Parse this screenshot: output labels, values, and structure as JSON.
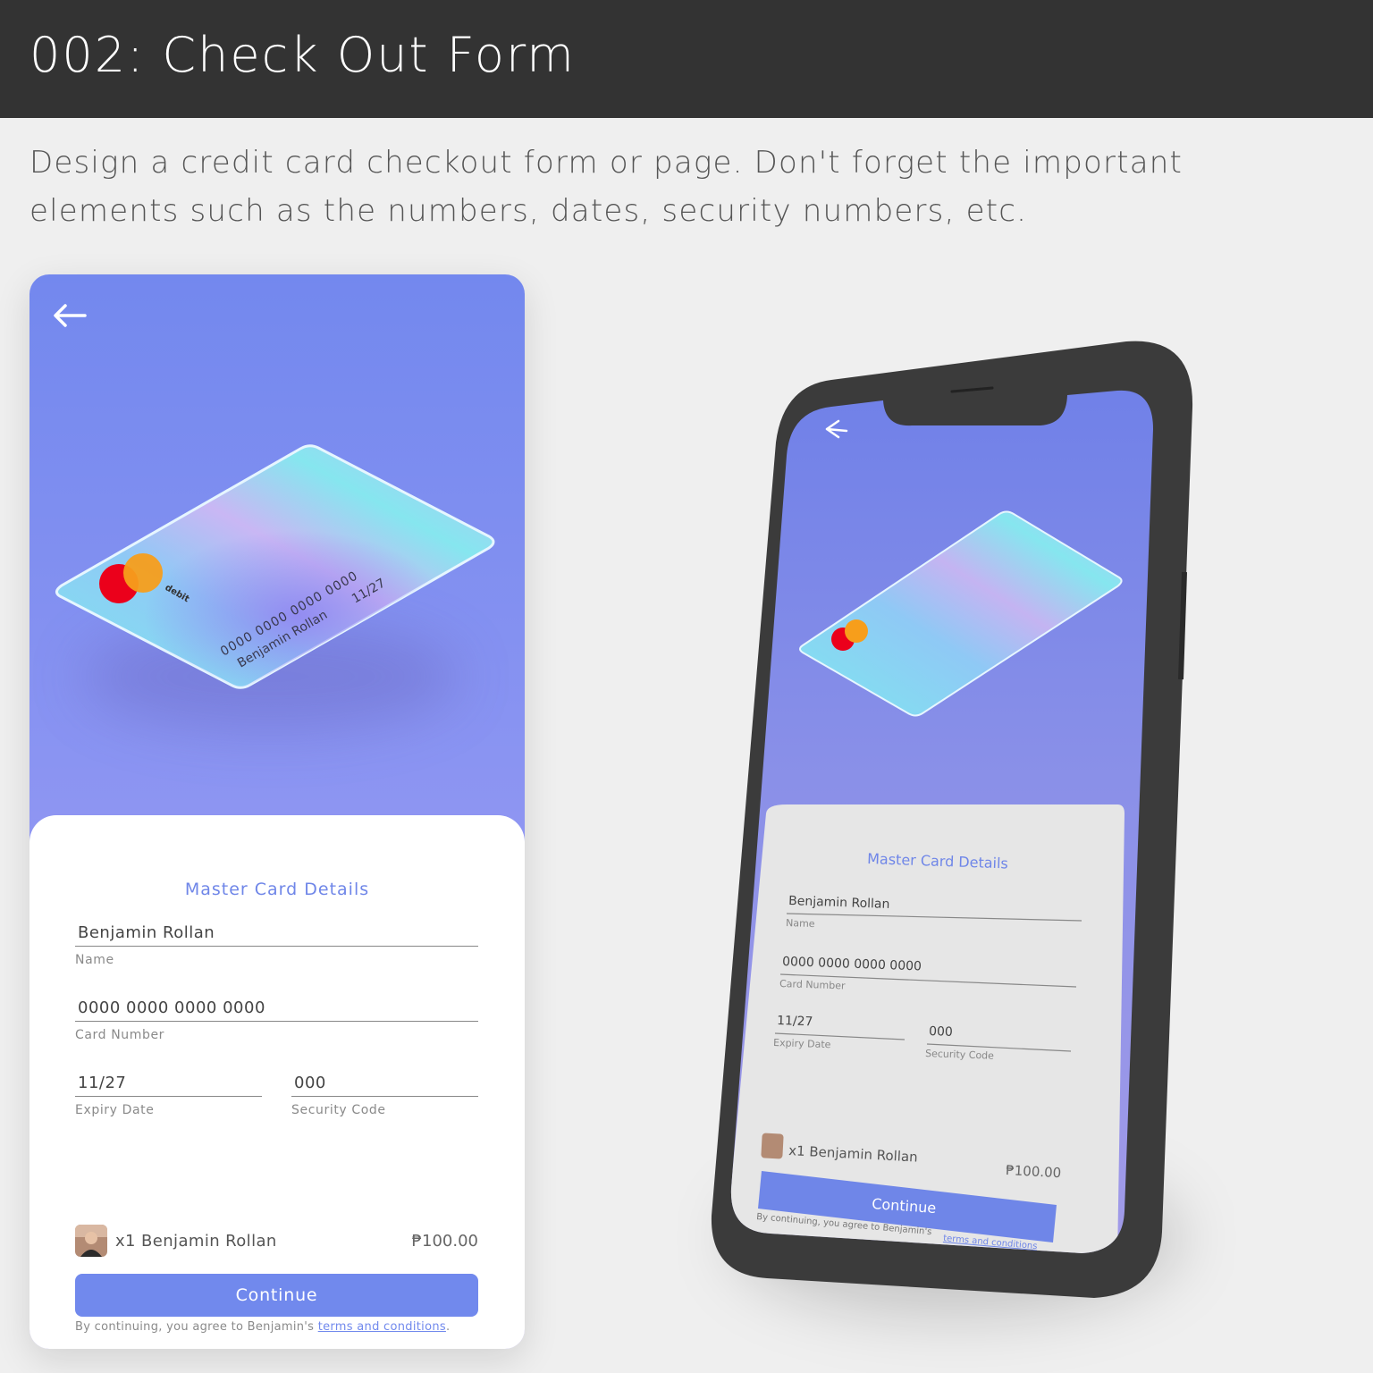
{
  "header": {
    "title": "002: Check Out Form"
  },
  "brief": {
    "line1": "Design a credit card checkout form or page. Don't forget the important",
    "line2": "elements such as the numbers, dates, security numbers, etc."
  },
  "card": {
    "brand": "debit",
    "number": "0000 0000 0000 0000",
    "holder": "Benjamin Rollan",
    "expiry": "11/27"
  },
  "form": {
    "title": "Master Card Details",
    "name": {
      "value": "Benjamin Rollan",
      "label": "Name"
    },
    "card_number": {
      "value": "0000 0000 0000 0000",
      "label": "Card Number"
    },
    "expiry": {
      "value": "11/27",
      "label": "Expiry Date"
    },
    "security": {
      "value": "000",
      "label": "Security Code"
    }
  },
  "order": {
    "item": "x1 Benjamin Rollan",
    "price": "₱100.00"
  },
  "actions": {
    "continue_label": "Continue",
    "terms_prefix": "By continuing, you agree to Benjamin's ",
    "terms_link": "terms and conditions",
    "terms_suffix": "."
  },
  "colors": {
    "accent": "#7189ed",
    "header_bg": "#333333",
    "page_bg": "#efefef",
    "mastercard_red": "#eb001b",
    "mastercard_orange": "#f79e1b"
  },
  "icons": {
    "back": "arrow-left-icon",
    "brand": "mastercard-logo"
  }
}
